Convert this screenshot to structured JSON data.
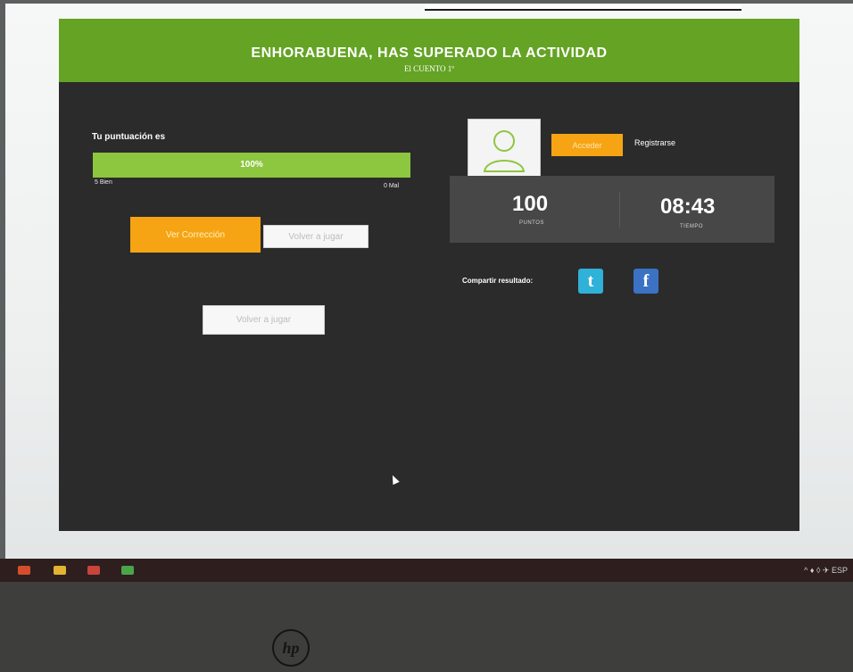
{
  "header": {
    "title": "ENHORABUENA, HAS SUPERADO LA ACTIVIDAD",
    "subtitle": "El CUENTO 1º"
  },
  "score": {
    "label": "Tu puntuación es",
    "percent_text": "100%",
    "percent": 100,
    "correct_text": "5 Bien",
    "wrong_text": "0 Mal"
  },
  "actions": {
    "ver_correccion": "Ver Corrección",
    "volver_a_jugar_1": "Volver a jugar",
    "volver_a_jugar_2": "Volver a jugar"
  },
  "account": {
    "acceder": "Acceder",
    "registrarse": "Registrarse"
  },
  "stats": {
    "points_value": "100",
    "points_label": "PUNTOS",
    "time_value": "08:43",
    "time_label": "TIEMPO"
  },
  "share": {
    "label": "Compartir resultado:",
    "twitter_glyph": "t",
    "facebook_glyph": "f"
  },
  "taskbar": {
    "tray_text": "^ ♦ ◊ ✈ ESP"
  },
  "logo": {
    "text": "hp"
  },
  "colors": {
    "header_green": "#64a324",
    "progress_green": "#8dc63f",
    "orange": "#f6a413",
    "panel_dark": "#2b2b2b",
    "stats_panel": "#474747",
    "twitter_blue": "#2fb1d8",
    "facebook_blue": "#3b72c4"
  }
}
